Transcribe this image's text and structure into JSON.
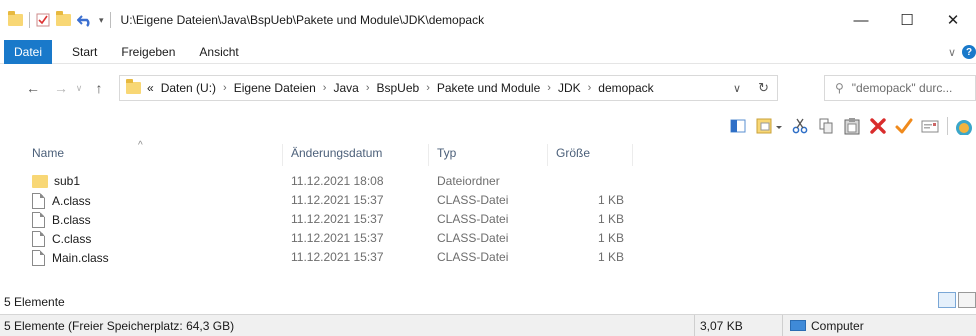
{
  "window": {
    "path": "U:\\Eigene Dateien\\Java\\BspUeb\\Pakete und Module\\JDK\\demopack",
    "minimize_glyph": "—",
    "maximize_glyph": "☐",
    "close_glyph": "✕"
  },
  "ribbon": {
    "tabs": [
      {
        "label": "Datei"
      },
      {
        "label": "Start"
      },
      {
        "label": "Freigeben"
      },
      {
        "label": "Ansicht"
      }
    ]
  },
  "address": {
    "overflow": "«",
    "crumbs": [
      "Daten (U:)",
      "Eigene Dateien",
      "Java",
      "BspUeb",
      "Pakete und Module",
      "JDK",
      "demopack"
    ]
  },
  "search": {
    "placeholder": "\"demopack\" durc..."
  },
  "columns": {
    "name": "Name",
    "date": "Änderungsdatum",
    "type": "Typ",
    "size": "Größe"
  },
  "files": [
    {
      "name": "sub1",
      "date": "11.12.2021 18:08",
      "type": "Dateiordner",
      "size": "",
      "icon": "folder-icon"
    },
    {
      "name": "A.class",
      "date": "11.12.2021 15:37",
      "type": "CLASS-Datei",
      "size": "1 KB",
      "icon": "file-icon"
    },
    {
      "name": "B.class",
      "date": "11.12.2021 15:37",
      "type": "CLASS-Datei",
      "size": "1 KB",
      "icon": "file-icon"
    },
    {
      "name": "C.class",
      "date": "11.12.2021 15:37",
      "type": "CLASS-Datei",
      "size": "1 KB",
      "icon": "file-icon"
    },
    {
      "name": "Main.class",
      "date": "11.12.2021 15:37",
      "type": "CLASS-Datei",
      "size": "1 KB",
      "icon": "file-icon"
    }
  ],
  "item_count": "5 Elemente",
  "status": {
    "left": "5 Elemente (Freier Speicherplatz: 64,3 GB)",
    "size": "3,07 KB",
    "location": "Computer"
  },
  "colors": {
    "accent": "#1979ca",
    "folder": "#f8d775",
    "delete_red": "#d92c2c",
    "check_orange": "#f08a1c"
  }
}
